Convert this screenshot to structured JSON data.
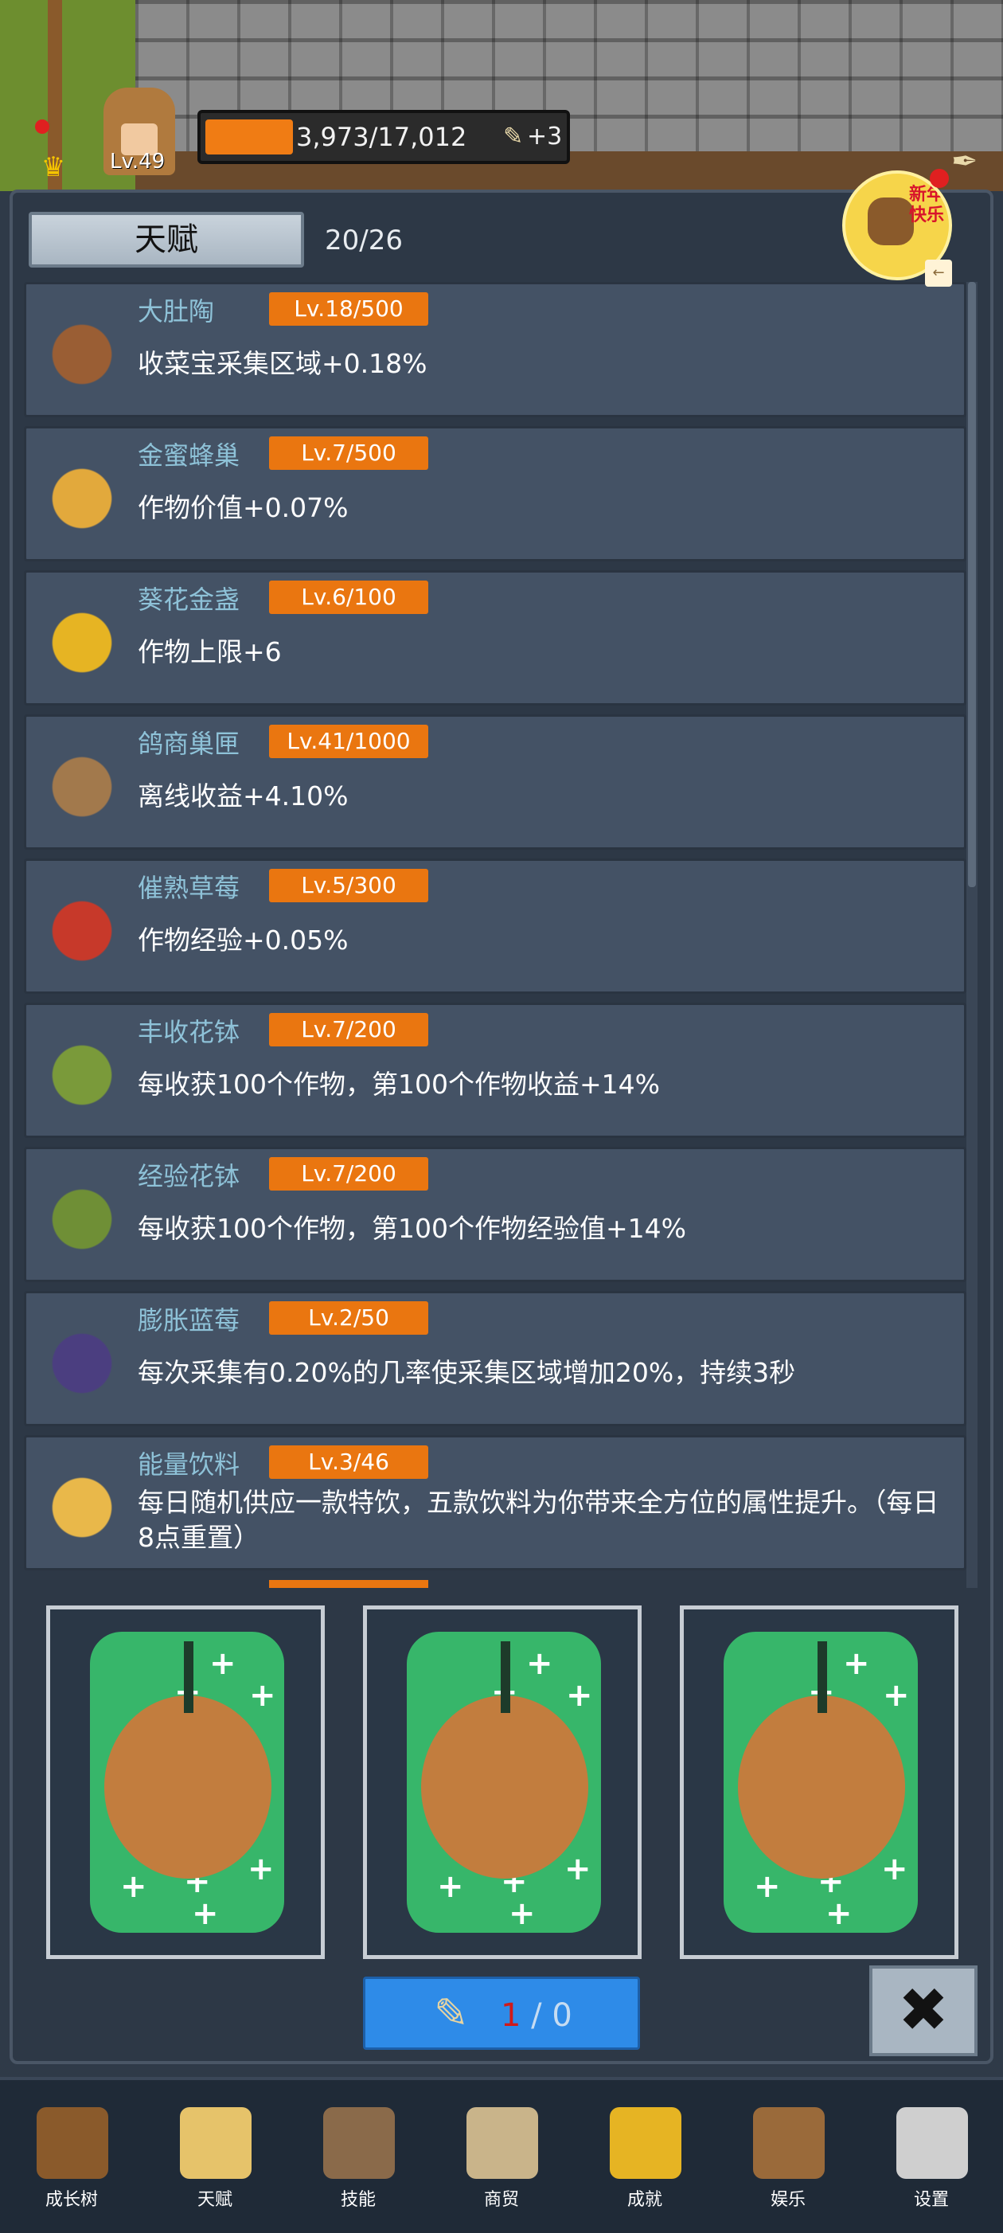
{
  "player": {
    "level": "Lv.49",
    "xp_text": "3,973/17,012",
    "xp_progress": 0.233,
    "scroll_bonus": "+3"
  },
  "event": {
    "label": "新年快乐"
  },
  "panel": {
    "title": "天赋",
    "count": "20/26"
  },
  "talents": [
    {
      "name": "大肚陶",
      "level": "Lv.18/500",
      "desc": "收菜宝采集区域+0.18%",
      "icon": "jar-icon",
      "color": "#9a5e34"
    },
    {
      "name": "金蜜蜂巢",
      "level": "Lv.7/500",
      "desc": "作物价值+0.07%",
      "icon": "honeycomb-icon",
      "color": "#e2a93c"
    },
    {
      "name": "葵花金盏",
      "level": "Lv.6/100",
      "desc": "作物上限+6",
      "icon": "sunflower-icon",
      "color": "#e6b423"
    },
    {
      "name": "鸽商巢匣",
      "level": "Lv.41/1000",
      "desc": "离线收益+4.10%",
      "icon": "birdhouse-icon",
      "color": "#a2794c"
    },
    {
      "name": "催熟草莓",
      "level": "Lv.5/300",
      "desc": "作物经验+0.05%",
      "icon": "strawberry-icon",
      "color": "#c7392a"
    },
    {
      "name": "丰收花钵",
      "level": "Lv.7/200",
      "desc": "每收获100个作物，第100个作物收益+14%",
      "icon": "plant-pot-icon",
      "color": "#7a9a3a"
    },
    {
      "name": "经验花钵",
      "level": "Lv.7/200",
      "desc": "每收获100个作物，第100个作物经验值+14%",
      "icon": "exp-pot-icon",
      "color": "#6f8f36"
    },
    {
      "name": "膨胀蓝莓",
      "level": "Lv.2/50",
      "desc": "每次采集有0.20%的几率使采集区域增加20%，持续3秒",
      "icon": "blueberry-icon",
      "color": "#4b3e80"
    },
    {
      "name": "能量饮料",
      "level": "Lv.3/46",
      "desc": "每日随机供应一款特饮，五款饮料为你带来全方位的属性提升。（每日8点重置）",
      "icon": "drink-icon",
      "color": "#e9b84a"
    }
  ],
  "cards": [
    "card-back",
    "card-back",
    "card-back"
  ],
  "roll": {
    "used": "1",
    "sep": " / ",
    "remaining": "0"
  },
  "close_label": "✖",
  "nav": [
    {
      "label": "成长树",
      "icon": "book-icon",
      "color": "#8a5a2b"
    },
    {
      "label": "天赋",
      "icon": "scroll-icon",
      "color": "#e6c36a"
    },
    {
      "label": "技能",
      "icon": "sword-icon",
      "color": "#8a6a4a"
    },
    {
      "label": "商贸",
      "icon": "map-icon",
      "color": "#c9b48a"
    },
    {
      "label": "成就",
      "icon": "key-icon",
      "color": "#e6b423"
    },
    {
      "label": "娱乐",
      "icon": "flag-icon",
      "color": "#9a6a3a"
    },
    {
      "label": "设置",
      "icon": "gear-icon",
      "color": "#cfcfcf"
    }
  ]
}
